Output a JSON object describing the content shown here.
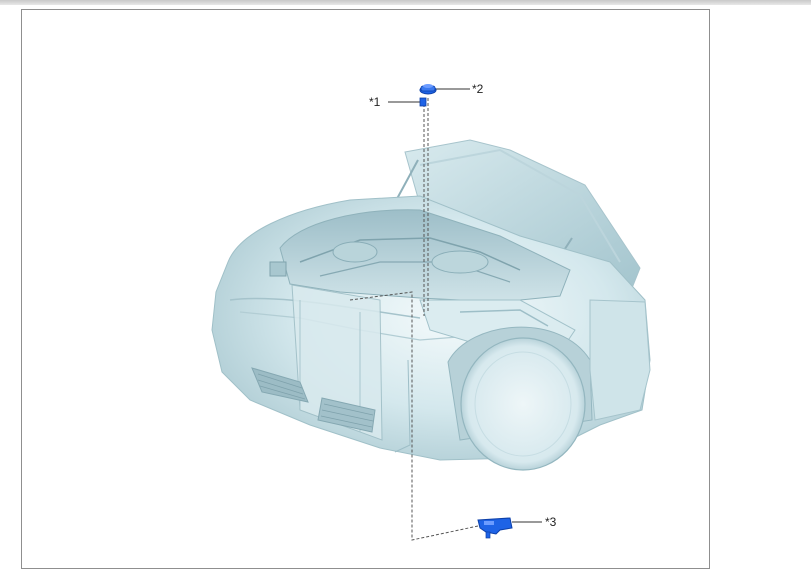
{
  "diagram": {
    "callouts": {
      "c1": "*1",
      "c2": "*2",
      "c3": "*3"
    },
    "parts": {
      "p1": "small-clip-icon",
      "p2": "cap-nut-icon",
      "p3": "bracket-clamp-icon"
    },
    "colors": {
      "part_blue": "#1e63e6",
      "car_body": "#cfe4ea",
      "car_shadow": "#8fb3bd",
      "leader_line": "#333333",
      "dashed_line": "#555555"
    }
  }
}
